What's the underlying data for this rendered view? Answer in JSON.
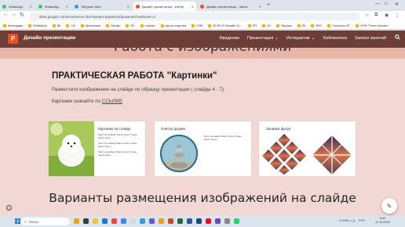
{
  "browser": {
    "tabs": [
      {
        "label": "WhatsApp",
        "color": "#25d366",
        "active": false
      },
      {
        "label": "WhatsApp",
        "color": "#25d366",
        "active": false
      },
      {
        "label": "Telegram Web",
        "color": "#2aa3df",
        "active": false
      },
      {
        "label": "Дизайн презентации - Изобр",
        "color": "#e94e1b",
        "active": true
      },
      {
        "label": "Дизайн презентации - Запис",
        "color": "#e94e1b",
        "active": false
      }
    ],
    "new_tab": "+",
    "url": "sites.google.com/view/serius-367/презентация/изображения?authuser=0",
    "bookmarks": [
      "Календарь",
      "WhatsApp",
      "ВК",
      "LM",
      "Школьники",
      "Профи",
      "ЯС",
      "старые",
      "карта сходства",
      "ГИМ",
      "20:05:00 Онлайн Тр...",
      "РП",
      "ИУ",
      "Музыка",
      "ЕК",
      "ФИУ",
      "Госуслуги ЕГ",
      "НПФ \"Успех-Альянс\""
    ]
  },
  "site": {
    "logo_letter": "P",
    "title": "Дизайн презентации",
    "nav": [
      {
        "label": "Введение"
      },
      {
        "label": "Презентация",
        "dropdown": true
      },
      {
        "label": "Интерактив",
        "dropdown": true
      },
      {
        "label": "Библиотека"
      },
      {
        "label": "Записи занятий"
      }
    ],
    "dropdown_glyph": "⌄",
    "search_glyph": "🔍"
  },
  "hero_title": "Работа с изображениями",
  "content": {
    "heading": "ПРАКТИЧЕСКАЯ РАБОТА \"Картинки\"",
    "instruction": "Разместите изображения на слайде по образцу презентации ( слайды 4 - 7).",
    "download_prefix": "Картинки скачайте по ",
    "download_link": "ССЫЛКЕ",
    "slides": [
      {
        "title": "Картинки на слайде",
        "bullets": [
          "Текст про собачку. Много текста. Очень много текста.",
          "Текст про собачку. Много текста. Очень много текста.",
          "Текст про собачку. Много текста. Очень много текста."
        ]
      },
      {
        "title": "Повтор формы",
        "bullets": [
          "Текст про камни. Много текста. Очень много текста."
        ]
      },
      {
        "title": "Заливка фигур",
        "bullets": []
      }
    ],
    "section_title": "Варианты размещения изображений на слайде"
  },
  "floating": {
    "info_glyph": "i",
    "edit_glyph": "✎"
  },
  "taskbar": {
    "search_placeholder": "Поиск",
    "tray": "∧  ENG  ⌂ ))",
    "lang": "РУС",
    "time": "9:09",
    "date": "11.10.2024"
  },
  "colors": {
    "header": "#6b3f37",
    "hero": "#e8b6a8",
    "page": "#f1d8d4",
    "accent": "#e94e1b"
  }
}
